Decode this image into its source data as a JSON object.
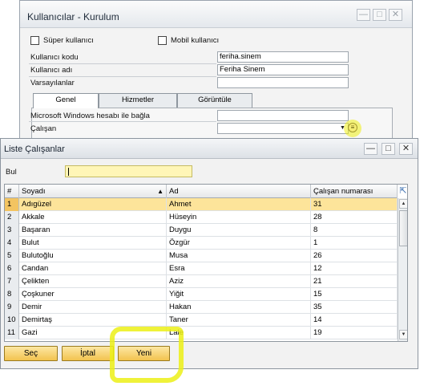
{
  "back_window": {
    "title": "Kullanıcılar - Kurulum",
    "controls": [
      "—",
      "□",
      "✕"
    ],
    "super_user_label": "Süper kullanıcı",
    "mobile_user_label": "Mobil kullanıcı",
    "user_code_label": "Kullanıcı kodu",
    "user_code_value": "feriha.sinem",
    "user_name_label": "Kullanıcı adı",
    "user_name_value": "Feriha Sinem",
    "defaults_label": "Varsayılanlar",
    "defaults_value": "",
    "tabs": [
      {
        "label": "Genel"
      },
      {
        "label": "Hizmetler"
      },
      {
        "label": "Görüntüle"
      }
    ],
    "windows_account_label": "Microsoft Windows hesabı ile bağla",
    "windows_account_value": "",
    "employee_label": "Çalışan",
    "employee_value": ""
  },
  "list_window": {
    "title": "Liste Çalışanlar",
    "controls": [
      "—",
      "□",
      "✕"
    ],
    "find_label": "Bul",
    "find_value": "",
    "columns": {
      "index": "#",
      "surname": "Soyadı",
      "name": "Ad",
      "employee_number": "Çalışan numarası"
    },
    "rows": [
      {
        "n": "1",
        "surname": "Adıgüzel",
        "name": "Ahmet",
        "emp": "31"
      },
      {
        "n": "2",
        "surname": "Akkale",
        "name": "Hüseyin",
        "emp": "28"
      },
      {
        "n": "3",
        "surname": "Başaran",
        "name": "Duygu",
        "emp": "8"
      },
      {
        "n": "4",
        "surname": "Bulut",
        "name": "Özgür",
        "emp": "1"
      },
      {
        "n": "5",
        "surname": "Bulutoğlu",
        "name": "Musa",
        "emp": "26"
      },
      {
        "n": "6",
        "surname": "Candan",
        "name": "Esra",
        "emp": "12"
      },
      {
        "n": "7",
        "surname": "Çelikten",
        "name": "Aziz",
        "emp": "21"
      },
      {
        "n": "8",
        "surname": "Çoşkuner",
        "name": "Yiğit",
        "emp": "15"
      },
      {
        "n": "9",
        "surname": "Demir",
        "name": "Hakan",
        "emp": "35"
      },
      {
        "n": "10",
        "surname": "Demirtaş",
        "name": "Taner",
        "emp": "14"
      },
      {
        "n": "11",
        "surname": "Gazi",
        "name": "Lale",
        "emp": "19"
      }
    ],
    "selected_row": "1",
    "buttons": {
      "choose": "Seç",
      "cancel": "İptal",
      "new": "Yeni"
    }
  },
  "colors": {
    "selected_row": "#fde49a",
    "button_fill": "#f2c34f",
    "find_field": "#fff6b7",
    "highlight_marker": "#ecf016"
  }
}
